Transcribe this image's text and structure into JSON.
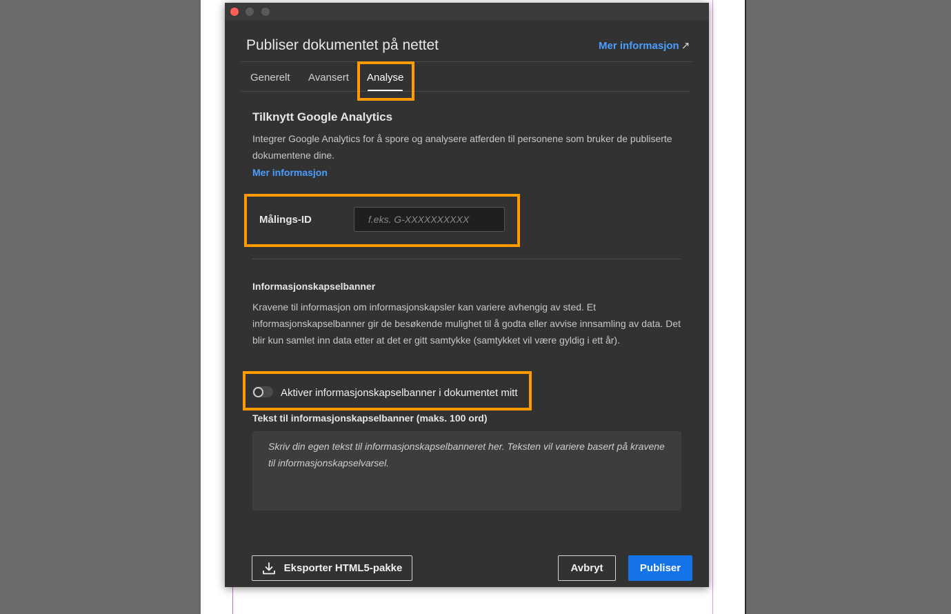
{
  "dialog": {
    "title": "Publiser dokumentet på nettet",
    "help_link": "Mer informasjon",
    "help_link_icon": "external-link-arrow"
  },
  "tabs": [
    {
      "label": "Generelt",
      "selected": false
    },
    {
      "label": "Avansert",
      "selected": false
    },
    {
      "label": "Analyse",
      "selected": true
    }
  ],
  "analytics": {
    "title": "Tilknytt Google Analytics",
    "description": "Integrer Google Analytics for å spore og analysere atferden til personene som bruker de publiserte dokumentene dine.",
    "link": "Mer informasjon",
    "measurement_label": "Målings-ID",
    "measurement_value": "",
    "measurement_placeholder": "f.eks. G-XXXXXXXXXX"
  },
  "cookie": {
    "title": "Informasjonskapselbanner",
    "description": "Kravene til informasjon om informasjonskapsler kan variere avhengig av sted. Et informasjonskapselbanner gir de besøkende mulighet til å godta eller avvise innsamling av data. Det blir kun samlet inn data etter at det er gitt samtykke (samtykket vil være gyldig i ett år).",
    "toggle_label": "Aktiver informasjonskapselbanner i dokumentet mitt",
    "toggle_on": false,
    "text_label": "Tekst til informasjonskapselbanner (maks. 100 ord)",
    "text_value": "",
    "text_placeholder": "Skriv din egen tekst til informasjonskapselbanneret her. Teksten vil variere basert på kravene til informasjonskapselvarsel."
  },
  "footer": {
    "export_label": "Eksporter HTML5-pakke",
    "export_icon": "download-icon",
    "cancel_label": "Avbryt",
    "publish_label": "Publiser"
  },
  "colors": {
    "accent_link": "#4a9eff",
    "primary_button": "#1473e6",
    "highlight_box": "#ff9a00",
    "dialog_bg": "#323232"
  }
}
